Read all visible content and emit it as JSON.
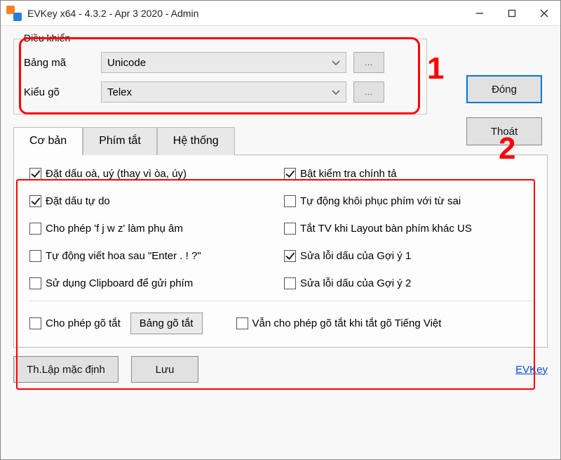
{
  "title": "EVKey x64 - 4.3.2 - Apr  3 2020 - Admin",
  "group": {
    "label": "Điều khiển",
    "rows": [
      {
        "label": "Bảng mã",
        "value": "Unicode"
      },
      {
        "label": "Kiểu gõ",
        "value": "Telex"
      }
    ]
  },
  "buttons": {
    "close": "Đóng",
    "exit": "Thoát",
    "defaults": "Th.Lập mặc định",
    "save": "Lưu",
    "shortcut_table": "Bảng gõ tắt"
  },
  "tabs": {
    "basic": "Cơ bản",
    "hotkeys": "Phím tắt",
    "system": "Hệ thống"
  },
  "options": {
    "o1": {
      "checked": true,
      "label": "Đặt dấu oà, uý (thay vì òa, úy)"
    },
    "o2": {
      "checked": true,
      "label": "Bật kiểm tra chính tả"
    },
    "o3": {
      "checked": true,
      "label": "Đặt dấu tự do"
    },
    "o4": {
      "checked": false,
      "label": "Tự động khôi phục phím với từ sai"
    },
    "o5": {
      "checked": false,
      "label": "Cho phép 'f j w z' làm phụ âm"
    },
    "o6": {
      "checked": false,
      "label": "Tắt TV khi Layout bàn phím khác US"
    },
    "o7": {
      "checked": false,
      "label": "Tự động viết hoa sau \"Enter . ! ?\""
    },
    "o8": {
      "checked": true,
      "label": "Sửa lỗi dấu của Gợi ý 1"
    },
    "o9": {
      "checked": false,
      "label": "Sử dụng Clipboard để gửi phím"
    },
    "o10": {
      "checked": false,
      "label": "Sửa lỗi dấu của Gợi ý 2"
    },
    "o11": {
      "checked": false,
      "label": "Cho phép gõ tắt"
    },
    "o12": {
      "checked": false,
      "label": "Vẫn cho phép gõ tắt khi tắt gõ Tiếng Việt"
    }
  },
  "link": "EVKey",
  "annotations": {
    "n1": "1",
    "n2": "2"
  }
}
